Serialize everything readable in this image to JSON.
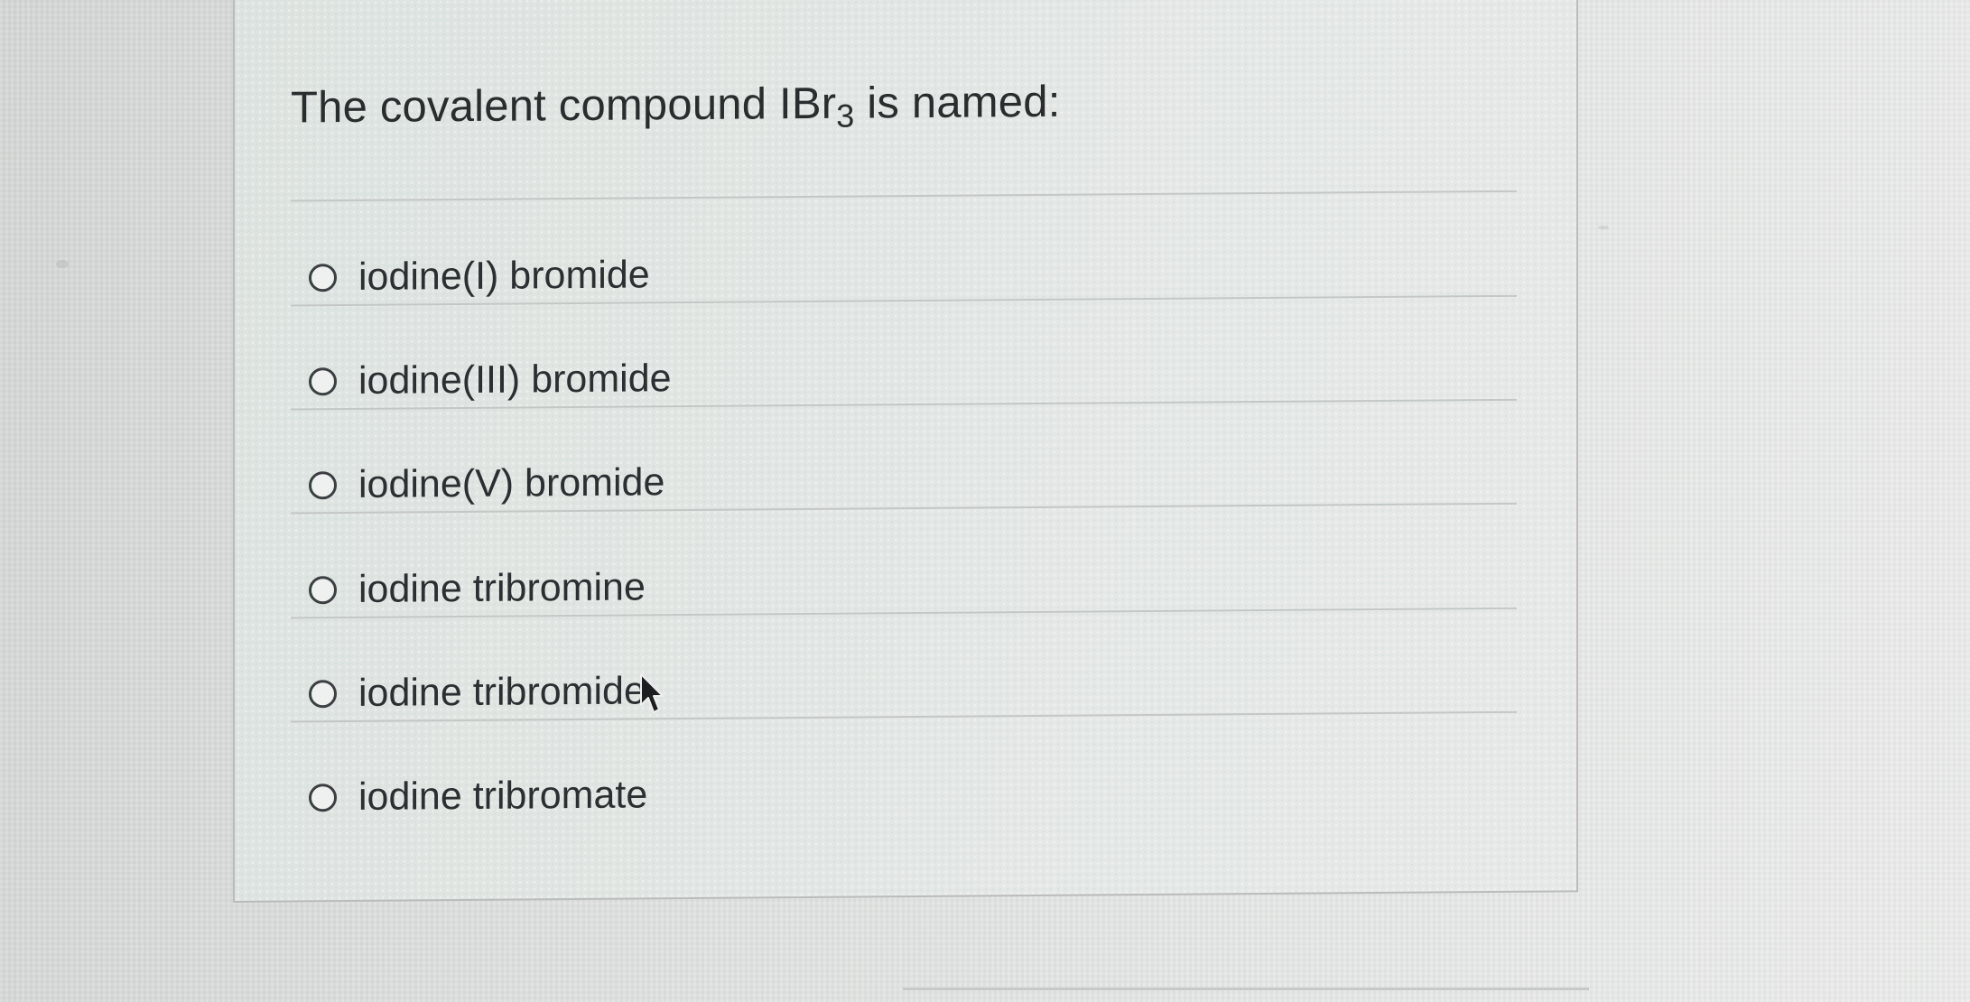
{
  "question": {
    "text_before": "The covalent compound IBr",
    "subscript": "3",
    "text_after": " is named:"
  },
  "options": [
    {
      "label": "iodine(I) bromide",
      "selected": false
    },
    {
      "label": "iodine(III) bromide",
      "selected": false
    },
    {
      "label": "iodine(V) bromide",
      "selected": false
    },
    {
      "label": "iodine tribromine",
      "selected": false
    },
    {
      "label": "iodine tribromide",
      "selected": false
    },
    {
      "label": "iodine tribromate",
      "selected": false
    }
  ],
  "colors": {
    "text": "#2a2d2e",
    "radio_border": "#3b3f41",
    "divider": "#c3c8c6",
    "panel_border": "#b9bcbb"
  }
}
